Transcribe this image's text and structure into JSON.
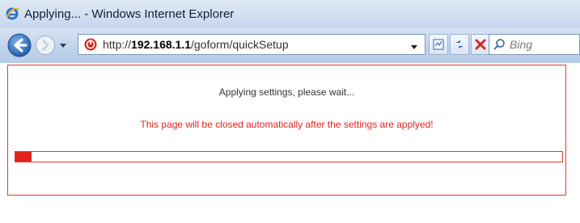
{
  "window": {
    "title": "Applying... - Windows Internet Explorer"
  },
  "navbar": {
    "address_prefix": "http://",
    "address_host": "192.168.1.1",
    "address_path": "/goform/quickSetup",
    "search_placeholder": "Bing"
  },
  "content": {
    "applying_text": "Applying settings, please wait...",
    "notice_text": "This page will be closed automatically after the settings are applyed!",
    "progress_fraction": 0.03
  },
  "colors": {
    "accent_red": "#e0241b",
    "frame_border": "#e23b2f"
  }
}
